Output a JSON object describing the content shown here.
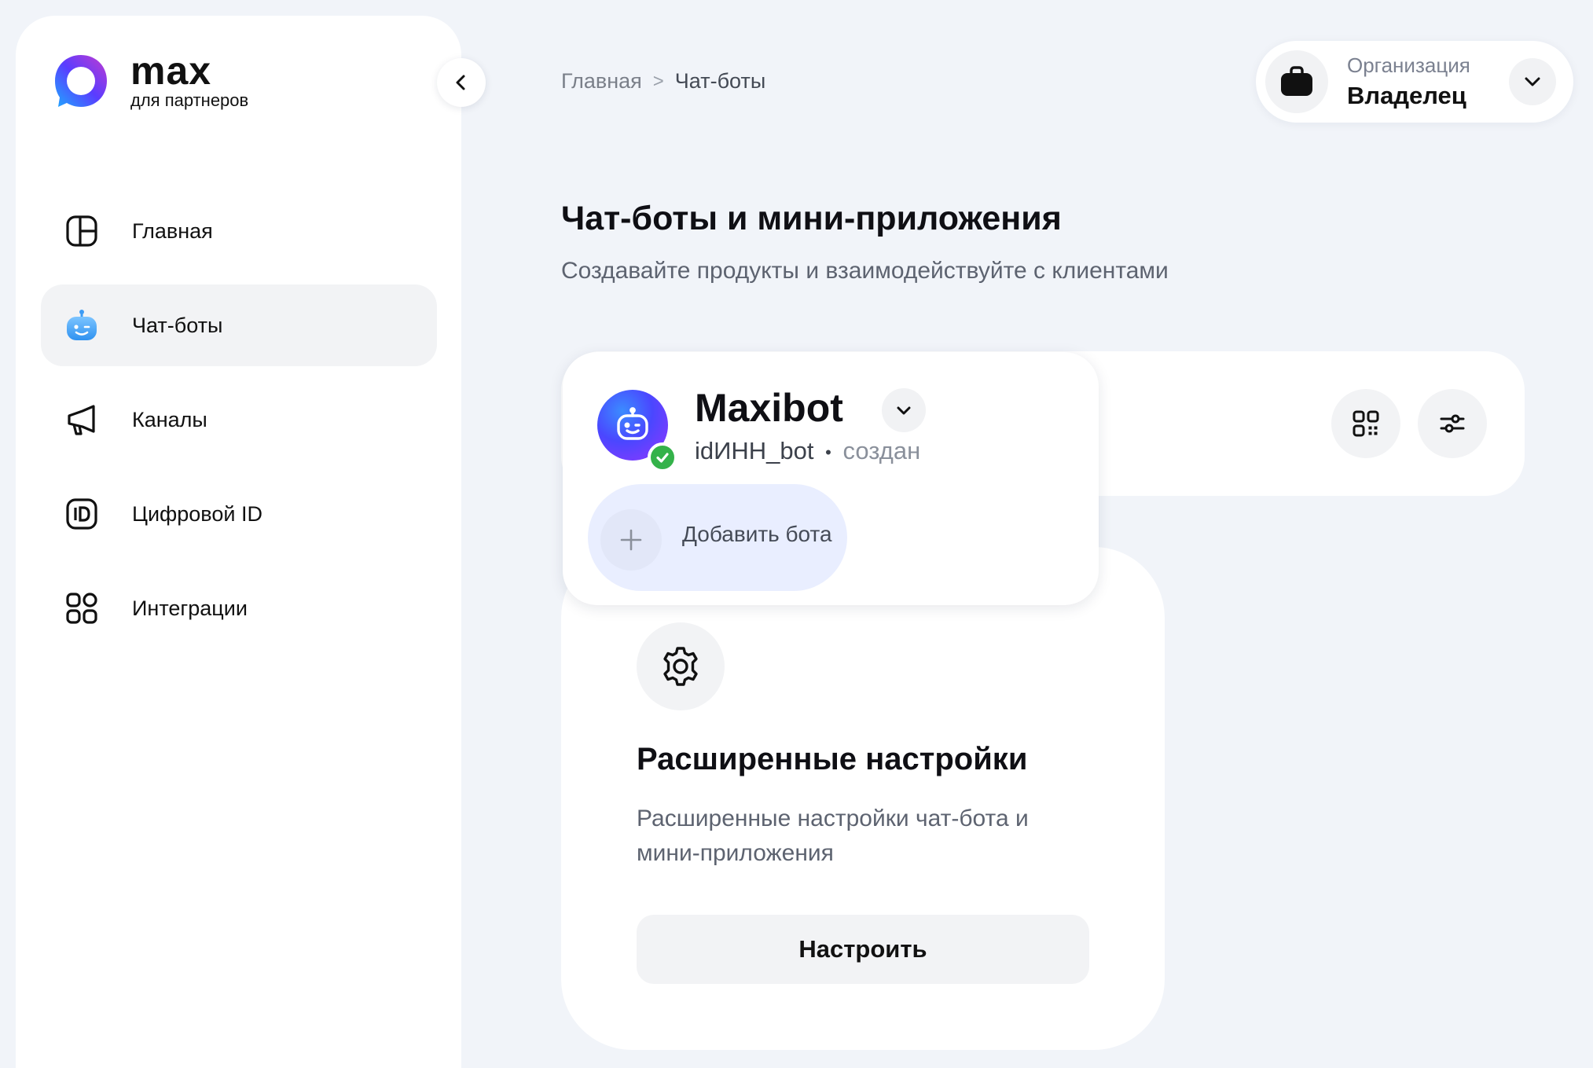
{
  "brand": {
    "title": "max",
    "subtitle": "для партнеров"
  },
  "sidebar": {
    "items": [
      {
        "label": "Главная",
        "icon": "dashboard-icon",
        "active": false
      },
      {
        "label": "Чат-боты",
        "icon": "bot-icon",
        "active": true
      },
      {
        "label": "Каналы",
        "icon": "megaphone-icon",
        "active": false
      },
      {
        "label": "Цифровой ID",
        "icon": "id-card-icon",
        "active": false
      },
      {
        "label": "Интеграции",
        "icon": "grid-apps-icon",
        "active": false
      }
    ]
  },
  "breadcrumb": {
    "home": "Главная",
    "separator": ">",
    "current": "Чат-боты"
  },
  "organization": {
    "label": "Организация",
    "role": "Владелец"
  },
  "page": {
    "title": "Чат-боты и мини-приложения",
    "subtitle": "Создавайте продукты и взаимодействуйте с клиентами"
  },
  "bot": {
    "name": "Maxibot",
    "username": "idИНН_bot",
    "separator": "•",
    "status": "создан",
    "verified": true,
    "add_label": "Добавить бота"
  },
  "settings_card": {
    "title": "Расширенные настройки",
    "description": "Расширенные настройки чат-бота и мини-приложения",
    "button": "Настроить"
  },
  "colors": {
    "background": "#f1f4f9",
    "surface": "#ffffff",
    "active_item": "#f2f3f5",
    "verified": "#34b24a",
    "add_bot_highlight": "#e9eeff",
    "brand_gradient": [
      "#2f7bff",
      "#6a3dff",
      "#b13fd3"
    ]
  }
}
